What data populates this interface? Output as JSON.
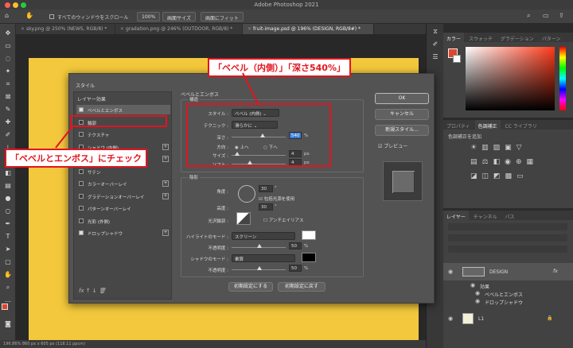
{
  "app_title": "Adobe Photoshop 2021",
  "options_bar": {
    "scroll_all_label": "すべてのウィンドウをスクロール",
    "zoom_btn": "100%",
    "fit_screen_btn": "画面サイズ",
    "fill_screen_btn": "画面にフィット"
  },
  "doc_tabs": [
    "sky.png @ 250% (NEWS, RGB/8) *",
    "gradation.png @ 246% (OUTDOOR, RGB/8) *",
    "fruit-image.psd @ 196% (DESIGN, RGB/8#) *"
  ],
  "status": "196.86%    860 px x 605 px (118.11 ppcm)",
  "dialog": {
    "left_header": "スタイル",
    "layer_effects": "レイヤー効果",
    "effects": [
      {
        "label": "ベベルとエンボス",
        "checked": true,
        "plus": false
      },
      {
        "label": "輪郭",
        "checked": false,
        "plus": false
      },
      {
        "label": "テクスチャ",
        "checked": false,
        "plus": false
      },
      {
        "label": "シャドウ (内側)",
        "checked": false,
        "plus": true
      },
      {
        "label": "光彩 (内側)",
        "checked": false,
        "plus": true
      },
      {
        "label": "サテン",
        "checked": false,
        "plus": false
      },
      {
        "label": "カラーオーバーレイ",
        "checked": false,
        "plus": true
      },
      {
        "label": "グラデーションオーバーレイ",
        "checked": false,
        "plus": true
      },
      {
        "label": "パターンオーバーレイ",
        "checked": false,
        "plus": false
      },
      {
        "label": "光彩 (外側)",
        "checked": false,
        "plus": false
      },
      {
        "label": "ドロップシャドウ",
        "checked": true,
        "plus": true
      }
    ],
    "section_title": "ベベルとエンボス",
    "structure_label": "構造",
    "style_label": "スタイル :",
    "style_value": "ベベル (内側)",
    "technique_label": "テクニック :",
    "technique_value": "滑らかに",
    "depth_label": "深さ :",
    "depth_value": "540",
    "direction_label": "方向 :",
    "dir_up": "上へ",
    "dir_down": "下へ",
    "size_label": "サイズ :",
    "size_value": "4",
    "soften_label": "ソフト :",
    "soften_value": "4",
    "unit_px": "px",
    "unit_pct": "%",
    "shading_label": "陰影",
    "angle_label": "角度 :",
    "angle_value": "30",
    "global_light": "包括光源を使用",
    "altitude_label": "高度 :",
    "altitude_value": "30",
    "gloss_label": "光沢輪郭 :",
    "anti_alias": "アンチエイリアス",
    "highlight_mode_label": "ハイライトのモード :",
    "highlight_mode": "スクリーン",
    "opacity_label": "不透明度 :",
    "highlight_opacity": "50",
    "shadow_mode_label": "シャドウのモード :",
    "shadow_mode": "乗算",
    "shadow_opacity": "50",
    "default_btn": "初期設定にする",
    "reset_btn": "初期設定に戻す",
    "ok_btn": "OK",
    "cancel_btn": "キャンセル",
    "new_style_btn": "新規スタイル...",
    "preview_label": "プレビュー",
    "fx_label": "fx"
  },
  "callouts": {
    "top": "「ベベル（内側）」「深さ540%」",
    "left": "「ベベルとエンボス」にチェック"
  },
  "panels": {
    "color_tabs": [
      "カラー",
      "スウォッチ",
      "グラデーション",
      "パターン"
    ],
    "adj_tabs": [
      "プロパティ",
      "色調補正",
      "CC ライブラリ"
    ],
    "adj_add_label": "色調補正を追加",
    "layer_tabs": [
      "レイヤー",
      "チャンネル",
      "パス"
    ],
    "layers": {
      "design": "DESIGN",
      "effects": "効果",
      "effect1": "ベベルとエンボス",
      "effect2": "ドロップシャドウ",
      "l1": "L1",
      "fx": "fx"
    }
  },
  "colors": {
    "callout_red": "#e2141e",
    "canvas_yellow": "#f3c83c",
    "foreground": "#e0452e"
  }
}
